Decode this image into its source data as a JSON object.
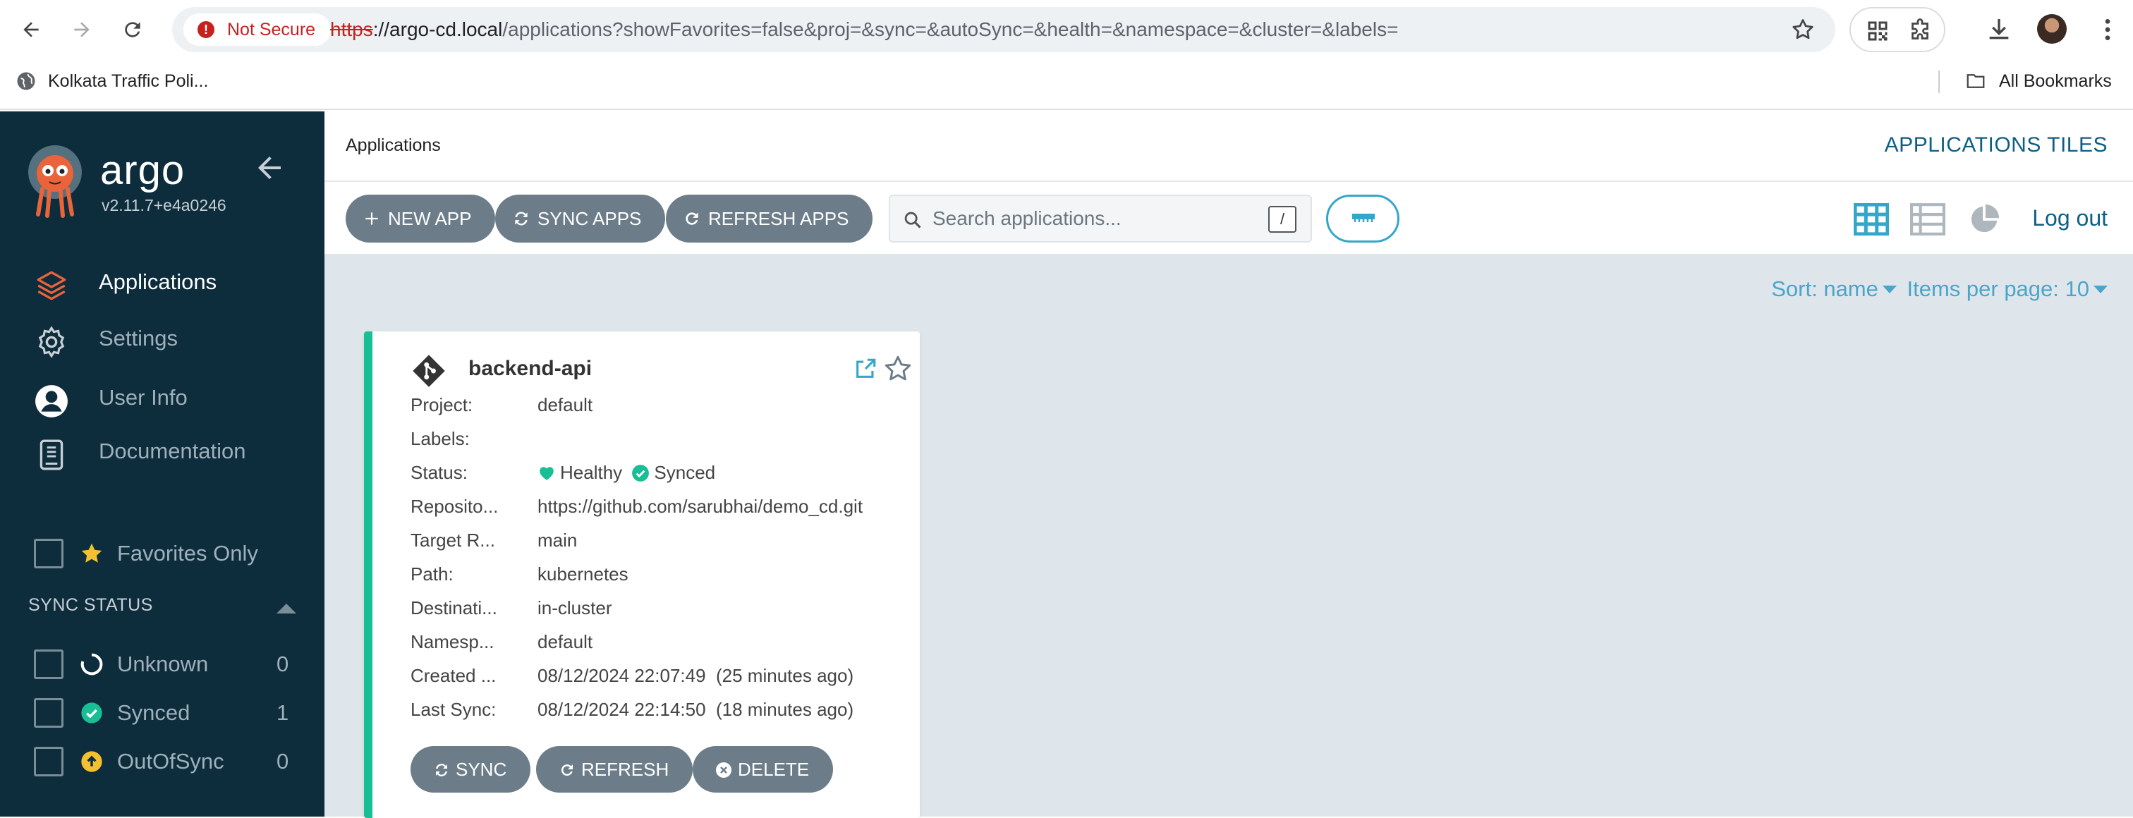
{
  "browser": {
    "security_label": "Not Secure",
    "url_scheme": "https",
    "url_host": "://argo-cd.local",
    "url_path": "/applications?showFavorites=false&proj=&sync=&autoSync=&health=&namespace=&cluster=&labels=",
    "bookmark_1": "Kolkata Traffic Poli...",
    "all_bookmarks": "All Bookmarks"
  },
  "sidebar": {
    "brand": "argo",
    "version": "v2.11.7+e4a0246",
    "nav": [
      {
        "label": "Applications",
        "icon": "layers-icon",
        "active": true
      },
      {
        "label": "Settings",
        "icon": "gear-icon",
        "active": false
      },
      {
        "label": "User Info",
        "icon": "user-icon",
        "active": false
      },
      {
        "label": "Documentation",
        "icon": "book-icon",
        "active": false
      }
    ],
    "favorites_label": "Favorites Only",
    "sync_status_title": "SYNC STATUS",
    "sync_filters": [
      {
        "label": "Unknown",
        "count": "0",
        "icon": "circle-notch-icon",
        "color": "#ffffff"
      },
      {
        "label": "Synced",
        "count": "1",
        "icon": "check-circle-icon",
        "color": "#18be94"
      },
      {
        "label": "OutOfSync",
        "count": "0",
        "icon": "arrow-up-circle-icon",
        "color": "#f4c030"
      }
    ]
  },
  "topbar": {
    "breadcrumb": "Applications",
    "view_title": "APPLICATIONS TILES"
  },
  "toolbar": {
    "new_app": "NEW APP",
    "sync_apps": "SYNC APPS",
    "refresh_apps": "REFRESH APPS",
    "search_placeholder": "Search applications...",
    "search_shortcut": "/",
    "logout": "Log out"
  },
  "sort": {
    "sort_label": "Sort: name",
    "items_label": "Items per page: 10"
  },
  "app_card": {
    "name": "backend-api",
    "rows": [
      {
        "key": "Project:",
        "value": "default"
      },
      {
        "key": "Labels:",
        "value": ""
      },
      {
        "key": "Status:",
        "health": "Healthy",
        "sync": "Synced"
      },
      {
        "key": "Reposito...",
        "value": "https://github.com/sarubhai/demo_cd.git"
      },
      {
        "key": "Target R...",
        "value": "main"
      },
      {
        "key": "Path:",
        "value": "kubernetes"
      },
      {
        "key": "Destinati...",
        "value": "in-cluster"
      },
      {
        "key": "Namesp...",
        "value": "default"
      },
      {
        "key": "Created ...",
        "value": "08/12/2024 22:07:49  (25 minutes ago)"
      },
      {
        "key": "Last Sync:",
        "value": "08/12/2024 22:14:50  (18 minutes ago)"
      }
    ],
    "sync_btn": "SYNC",
    "refresh_btn": "REFRESH",
    "delete_btn": "DELETE"
  },
  "colors": {
    "sidebar_bg": "#0d2c3c",
    "accent": "#18be94",
    "link": "#0e5f84",
    "button": "#6c7d89"
  }
}
